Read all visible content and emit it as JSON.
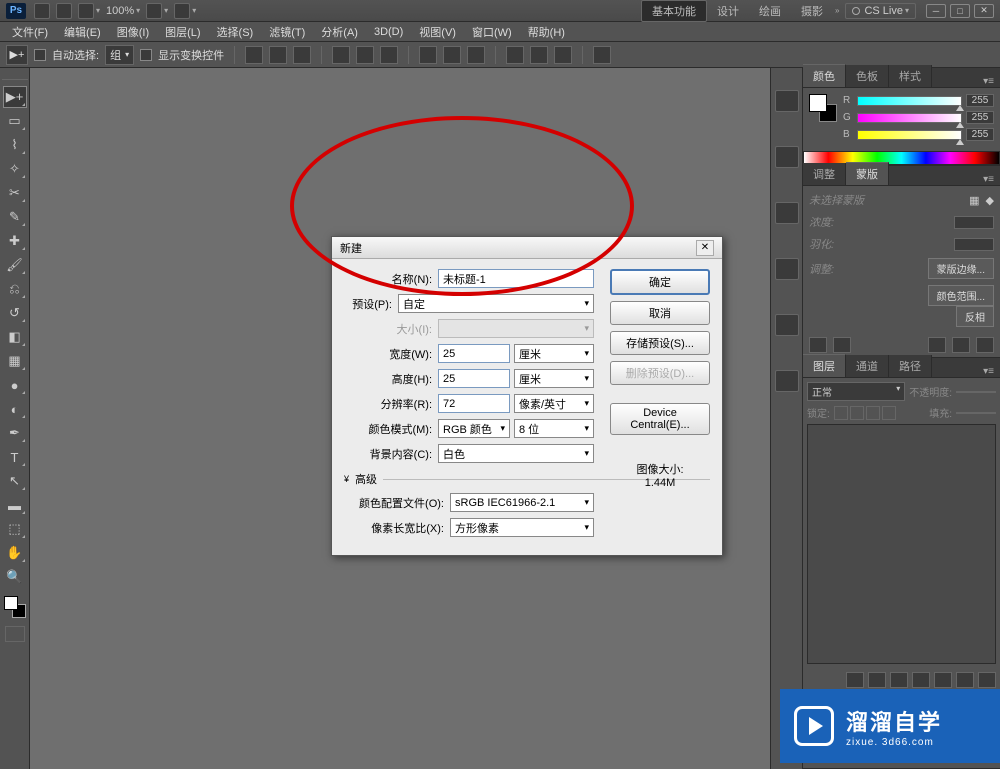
{
  "titlebar": {
    "ps": "Ps",
    "zoom": "100%",
    "modes": [
      "基本功能",
      "设计",
      "绘画",
      "摄影"
    ],
    "cslive": "CS Live"
  },
  "menu": [
    "文件(F)",
    "编辑(E)",
    "图像(I)",
    "图层(L)",
    "选择(S)",
    "滤镜(T)",
    "分析(A)",
    "3D(D)",
    "视图(V)",
    "窗口(W)",
    "帮助(H)"
  ],
  "optbar": {
    "autoselect": "自动选择:",
    "group": "组",
    "showtransform": "显示变换控件"
  },
  "panels": {
    "color": {
      "tabs": [
        "颜色",
        "色板",
        "样式"
      ],
      "r": "R",
      "g": "G",
      "b": "B",
      "val": "255"
    },
    "mask": {
      "tabs": [
        "调整",
        "蒙版"
      ],
      "nosel": "未选择蒙版",
      "density": "浓度:",
      "feather": "羽化:",
      "adjust": "调整:",
      "maskedge": "蒙版边缘...",
      "colorrange": "颜色范围...",
      "invert": "反相"
    },
    "layer": {
      "tabs": [
        "图层",
        "通道",
        "路径"
      ],
      "blend": "正常",
      "opacity_l": "不透明度:",
      "opacity_v": "",
      "lock": "锁定:",
      "fill_l": "填充:",
      "fill_v": ""
    }
  },
  "dialog": {
    "title": "新建",
    "name_l": "名称(N):",
    "name_v": "未标题-1",
    "preset_l": "预设(P):",
    "preset_v": "自定",
    "size_l": "大小(I):",
    "w_l": "宽度(W):",
    "w_v": "25",
    "w_u": "厘米",
    "h_l": "高度(H):",
    "h_v": "25",
    "h_u": "厘米",
    "res_l": "分辨率(R):",
    "res_v": "72",
    "res_u": "像素/英寸",
    "mode_l": "颜色模式(M):",
    "mode_v": "RGB 颜色",
    "depth": "8 位",
    "bg_l": "背景内容(C):",
    "bg_v": "白色",
    "adv": "高级",
    "profile_l": "颜色配置文件(O):",
    "profile_v": "sRGB IEC61966-2.1",
    "aspect_l": "像素长宽比(X):",
    "aspect_v": "方形像素",
    "ok": "确定",
    "cancel": "取消",
    "save": "存储预设(S)...",
    "delete": "删除预设(D)...",
    "device": "Device Central(E)...",
    "imgsize_l": "图像大小:",
    "imgsize_v": "1.44M"
  },
  "watermark": {
    "t1": "溜溜自学",
    "t2": "zixue. 3d66.com"
  }
}
